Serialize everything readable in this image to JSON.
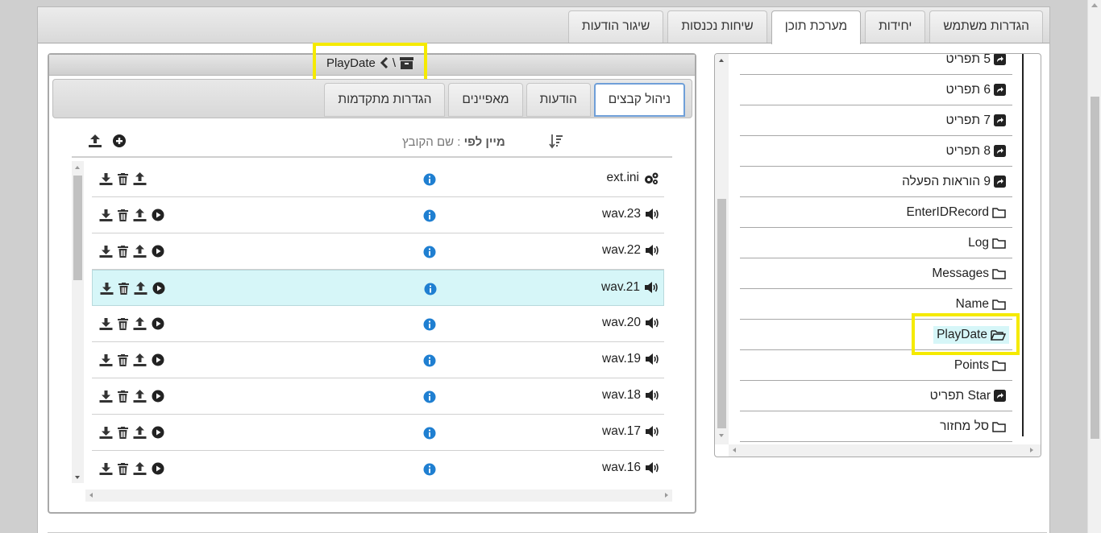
{
  "tabs": [
    {
      "label": "הגדרות משתמש",
      "active": false
    },
    {
      "label": "יחידות",
      "active": false
    },
    {
      "label": "מערכת תוכן",
      "active": true
    },
    {
      "label": "שיחות נכנסות",
      "active": false
    },
    {
      "label": "שיגור הודעות",
      "active": false
    }
  ],
  "breadcrumb": {
    "separator": "\\",
    "folder": "PlayDate"
  },
  "subtabs": [
    {
      "label": "ניהול קבצים",
      "active": true
    },
    {
      "label": "הודעות",
      "active": false
    },
    {
      "label": "מאפיינים",
      "active": false
    },
    {
      "label": "הגדרות מתקדמות",
      "active": false
    }
  ],
  "toolbar": {
    "sort_prefix": "מיין לפי",
    "sort_value": ": שם הקובץ"
  },
  "files": [
    {
      "name": "ext.ini",
      "type": "settings",
      "selected": false,
      "playable": false
    },
    {
      "name": "wav.23",
      "type": "audio",
      "selected": false,
      "playable": true
    },
    {
      "name": "wav.22",
      "type": "audio",
      "selected": false,
      "playable": true
    },
    {
      "name": "wav.21",
      "type": "audio",
      "selected": true,
      "playable": true
    },
    {
      "name": "wav.20",
      "type": "audio",
      "selected": false,
      "playable": true
    },
    {
      "name": "wav.19",
      "type": "audio",
      "selected": false,
      "playable": true
    },
    {
      "name": "wav.18",
      "type": "audio",
      "selected": false,
      "playable": true
    },
    {
      "name": "wav.17",
      "type": "audio",
      "selected": false,
      "playable": true
    },
    {
      "name": "wav.16",
      "type": "audio",
      "selected": false,
      "playable": true
    }
  ],
  "tree": [
    {
      "label": "5 תפריט",
      "icon": "shortcut-icon"
    },
    {
      "label": "6 תפריט",
      "icon": "shortcut-icon"
    },
    {
      "label": "7 תפריט",
      "icon": "shortcut-icon"
    },
    {
      "label": "8 תפריט",
      "icon": "shortcut-icon"
    },
    {
      "label": "9 הוראות הפעלה",
      "icon": "shortcut-icon"
    },
    {
      "label": "EnterIDRecord",
      "icon": "folder-icon"
    },
    {
      "label": "Log",
      "icon": "folder-icon"
    },
    {
      "label": "Messages",
      "icon": "folder-icon"
    },
    {
      "label": "Name",
      "icon": "folder-icon"
    },
    {
      "label": "PlayDate",
      "icon": "folder-open-icon",
      "selected": true
    },
    {
      "label": "Points",
      "icon": "folder-icon"
    },
    {
      "label": "Star תפריט",
      "icon": "shortcut-icon"
    },
    {
      "label": "סל מחזור",
      "icon": "folder-icon"
    }
  ],
  "colors": {
    "selected_row": "#d6f6f8",
    "highlight": "#f5ea00",
    "info": "#1f7fd1",
    "active_tab_border": "#6f9fd8"
  }
}
